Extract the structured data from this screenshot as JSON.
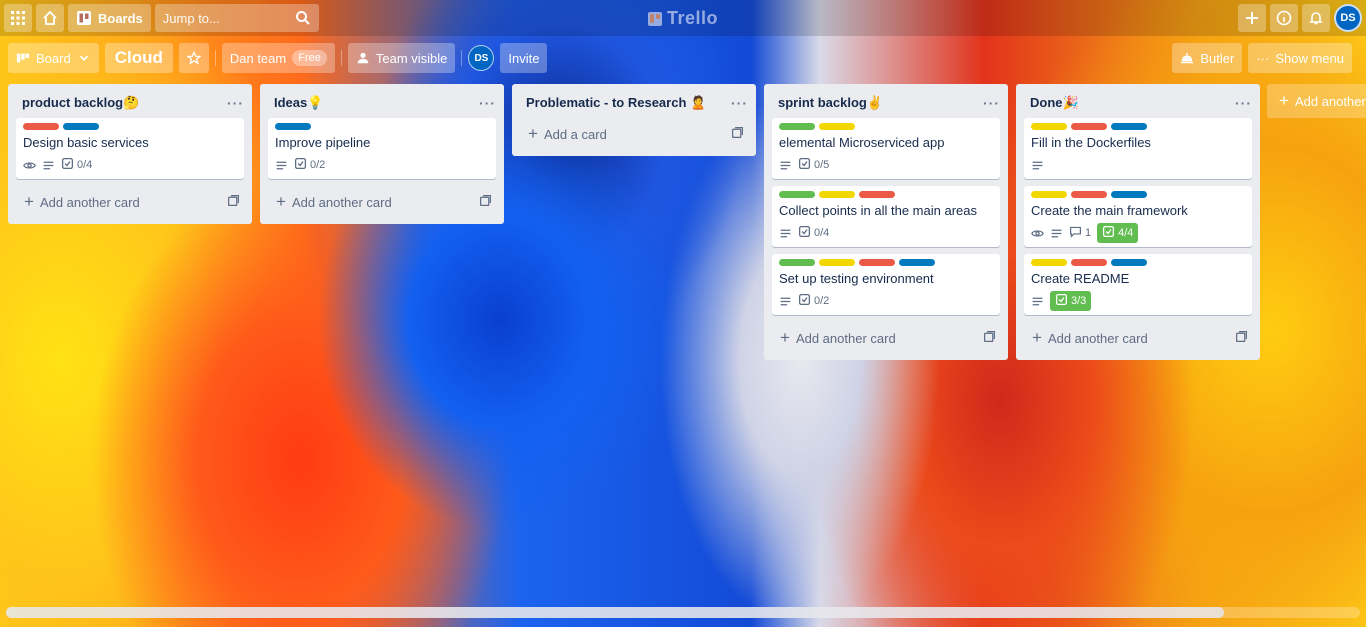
{
  "header": {
    "boards_label": "Boards",
    "search_placeholder": "Jump to...",
    "logo_text": "Trello",
    "user_initials": "DS"
  },
  "board": {
    "view_label": "Board",
    "name": "Cloud",
    "team_label": "Dan team",
    "plan_badge": "Free",
    "visibility_label": "Team visible",
    "member_initials": "DS",
    "invite_label": "Invite",
    "butler_label": "Butler",
    "menu_label": "Show menu"
  },
  "colors": {
    "red": "#eb5a46",
    "blue": "#0079bf",
    "green": "#61bd4f",
    "yellow": "#f2d600"
  },
  "lists": [
    {
      "title": "product backlog🤔",
      "add_label": "Add another card",
      "cards": [
        {
          "title": "Design basic services",
          "labels": [
            "red",
            "blue"
          ],
          "watch": true,
          "description": true,
          "checklist": "0/4"
        }
      ]
    },
    {
      "title": "Ideas💡",
      "add_label": "Add another card",
      "cards": [
        {
          "title": "Improve pipeline",
          "labels": [
            "blue"
          ],
          "description": true,
          "checklist": "0/2"
        }
      ]
    },
    {
      "title": "Problematic - to Research 🙎",
      "add_label": "Add a card",
      "cards": []
    },
    {
      "title": "sprint backlog✌",
      "add_label": "Add another card",
      "cards": [
        {
          "title": "elemental Microserviced app",
          "labels": [
            "green",
            "yellow"
          ],
          "description": true,
          "checklist": "0/5"
        },
        {
          "title": "Collect points in all the main areas",
          "labels": [
            "green",
            "yellow",
            "red"
          ],
          "description": true,
          "checklist": "0/4"
        },
        {
          "title": "Set up testing environment",
          "labels": [
            "green",
            "yellow",
            "red",
            "blue"
          ],
          "description": true,
          "checklist": "0/2"
        }
      ]
    },
    {
      "title": "Done🎉",
      "add_label": "Add another card",
      "cards": [
        {
          "title": "Fill in the Dockerfiles",
          "labels": [
            "yellow",
            "red",
            "blue"
          ],
          "description": true
        },
        {
          "title": "Create the main framework",
          "labels": [
            "yellow",
            "red",
            "blue"
          ],
          "watch": true,
          "description": true,
          "comments": "1",
          "checklist": "4/4",
          "checklist_done": true
        },
        {
          "title": "Create README",
          "labels": [
            "yellow",
            "red",
            "blue"
          ],
          "description": true,
          "checklist": "3/3",
          "checklist_done": true
        }
      ]
    }
  ],
  "add_list_label": "Add another list"
}
